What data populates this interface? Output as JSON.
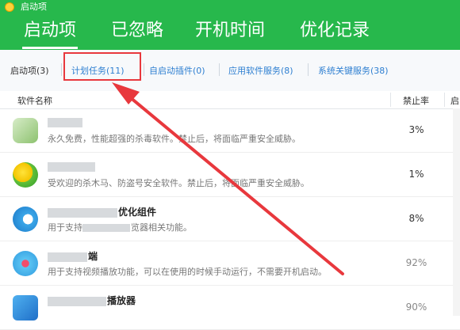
{
  "app": {
    "title": "启动项"
  },
  "main_tabs": [
    {
      "label": "启动项"
    },
    {
      "label": "已忽略"
    },
    {
      "label": "开机时间"
    },
    {
      "label": "优化记录"
    }
  ],
  "sub_tabs": [
    {
      "label": "启动项(3)"
    },
    {
      "label": "计划任务(11)"
    },
    {
      "label": "自启动插件(0)"
    },
    {
      "label": "应用软件服务(8)"
    },
    {
      "label": "系统关键服务(38)"
    }
  ],
  "columns": {
    "name": "软件名称",
    "ban_rate": "禁止率",
    "third": "启"
  },
  "rows": [
    {
      "name": "",
      "desc": "永久免费，性能超强的杀毒软件。禁止后，将面临严重安全威胁。",
      "rate": "3%",
      "icon": "shield-green-icon"
    },
    {
      "name": "",
      "desc": "受欢迎的杀木马、防盗号安全软件。禁止后，将面临严重安全威胁。",
      "rate": "1%",
      "icon": "security-guard-icon"
    },
    {
      "name": "优化组件",
      "desc": "用于支持",
      "desc2": "览器相关功能。",
      "rate": "8%",
      "icon": "browser-icon"
    },
    {
      "name": "端",
      "desc": "用于支持视频播放功能，可以在使用的时候手动运行，不需要开机启动。",
      "rate": "92%",
      "icon": "video-player-icon"
    },
    {
      "name": "播放器",
      "desc": "",
      "rate": "90%",
      "icon": "music-player-icon"
    }
  ],
  "colors": {
    "header_green": "#27b84c",
    "highlight_red": "#e8383d",
    "link_blue": "#2e7fd1"
  }
}
